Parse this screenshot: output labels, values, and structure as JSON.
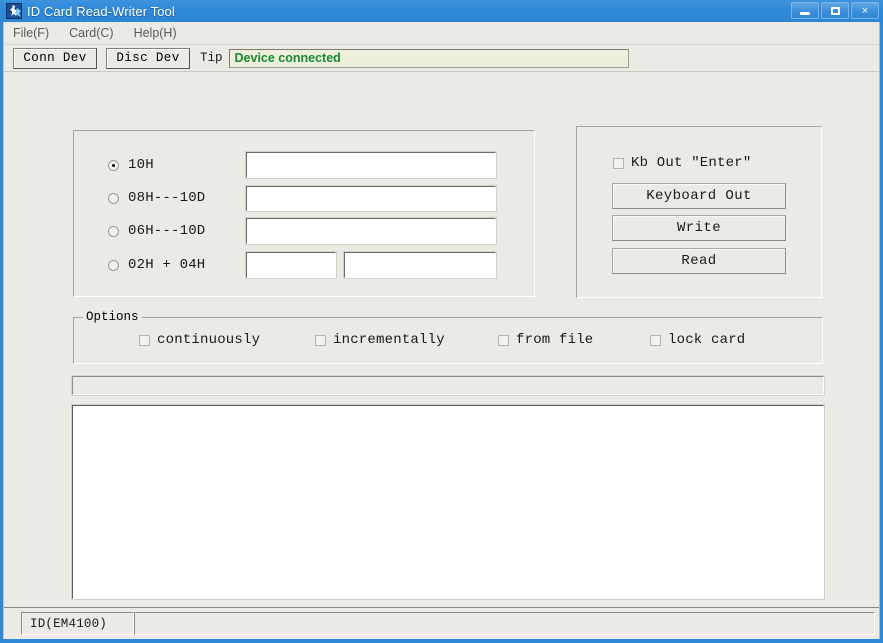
{
  "window": {
    "title": "ID Card Read-Writer Tool",
    "icon": "app-runner-icon",
    "controls": {
      "minimize": "minimize-icon",
      "maximize": "maximize-icon",
      "close": "×"
    },
    "accent_color": "#2f89d8",
    "client_background": "#eceae4"
  },
  "menu": {
    "items": [
      {
        "label": "File(F)"
      },
      {
        "label": "Card(C)"
      },
      {
        "label": "Help(H)"
      }
    ]
  },
  "toolbar": {
    "connect_label": "Conn Dev",
    "disconnect_label": "Disc Dev",
    "tip_label": "Tip",
    "tip_text": "Device connected",
    "tip_color": "#158a2e",
    "tip_background": "#eeeedd"
  },
  "mode_group": {
    "options": [
      {
        "label": "10H",
        "checked": true,
        "fields": [
          {
            "value": "",
            "placeholder": ""
          }
        ]
      },
      {
        "label": "08H---10D",
        "checked": false,
        "fields": [
          {
            "value": "",
            "placeholder": ""
          }
        ]
      },
      {
        "label": "06H---10D",
        "checked": false,
        "fields": [
          {
            "value": "",
            "placeholder": ""
          }
        ]
      },
      {
        "label": "02H + 04H",
        "checked": false,
        "fields": [
          {
            "value": "",
            "placeholder": ""
          },
          {
            "value": "",
            "placeholder": ""
          }
        ]
      }
    ]
  },
  "action_group": {
    "kb_out_checkbox": {
      "label": "Kb Out ″Enter″",
      "checked": false
    },
    "buttons": [
      {
        "label": "Keyboard Out"
      },
      {
        "label": "Write"
      },
      {
        "label": "Read"
      }
    ]
  },
  "options_group": {
    "legend": "Options",
    "checkboxes": [
      {
        "label": "continuously",
        "checked": false
      },
      {
        "label": "incrementally",
        "checked": false
      },
      {
        "label": "from file",
        "checked": false
      },
      {
        "label": "lock card",
        "checked": false
      }
    ]
  },
  "progress": {
    "value": 0,
    "max": 100
  },
  "log": {
    "value": "",
    "placeholder": ""
  },
  "status_bar": {
    "card_type": "ID(EM4100)",
    "secondary": ""
  }
}
